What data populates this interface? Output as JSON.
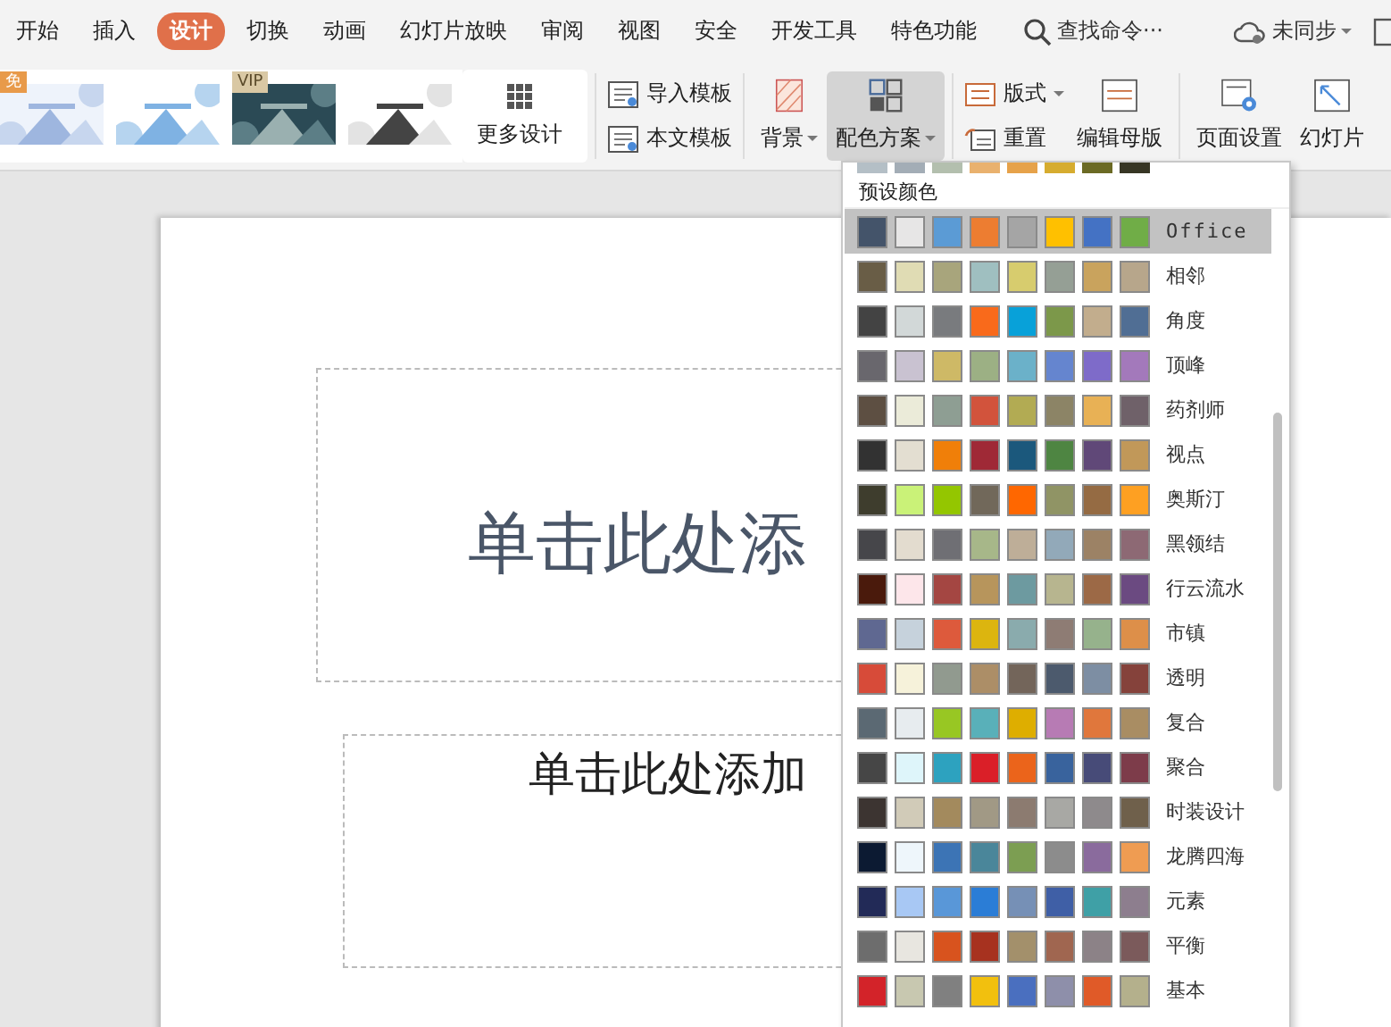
{
  "tabs": [
    {
      "label": "开始",
      "selected": false
    },
    {
      "label": "插入",
      "selected": false
    },
    {
      "label": "设计",
      "selected": true
    },
    {
      "label": "切换",
      "selected": false
    },
    {
      "label": "动画",
      "selected": false
    },
    {
      "label": "幻灯片放映",
      "selected": false
    },
    {
      "label": "审阅",
      "selected": false
    },
    {
      "label": "视图",
      "selected": false
    },
    {
      "label": "安全",
      "selected": false
    },
    {
      "label": "开发工具",
      "selected": false
    },
    {
      "label": "特色功能",
      "selected": false
    }
  ],
  "search": {
    "placeholder": "查找命令···"
  },
  "sync": {
    "label": "未同步"
  },
  "ribbon": {
    "designs": [
      {
        "kind": "picture",
        "badge": "免"
      },
      {
        "kind": "picture"
      },
      {
        "kind": "picture",
        "badge": "VIP"
      },
      {
        "kind": "picture"
      }
    ],
    "more_designs": "更多设计",
    "template_buttons": [
      "导入模板",
      "本文模板"
    ],
    "background": "背景",
    "color_scheme": {
      "label": "配色方案",
      "open": true
    },
    "layout_buttons": [
      "版式",
      "重置"
    ],
    "edit_master": "编辑母版",
    "page_setup": "页面设置",
    "slide_size": "幻灯片"
  },
  "slide": {
    "title_placeholder": "单击此处添",
    "subtitle_placeholder": "单击此处添加"
  },
  "color_menu": {
    "top_row": [
      {
        "color": "#b4bfc6"
      },
      {
        "color": "#a3adb6"
      },
      {
        "color": "#b3bfae"
      },
      {
        "color": "#e9b16e"
      },
      {
        "color": "#e6a24a"
      },
      {
        "color": "#d6ac2f"
      },
      {
        "color": "#6b6a24"
      },
      {
        "color": "#373624"
      }
    ],
    "header": "预设颜色",
    "schemes": [
      {
        "name": "Office",
        "selected": true,
        "swatches": [
          {
            "color": "#44546a"
          },
          {
            "color": "#e7e6e6"
          },
          {
            "color": "#5b9bd5"
          },
          {
            "color": "#ed7d31"
          },
          {
            "color": "#a5a5a5"
          },
          {
            "color": "#ffc000"
          },
          {
            "color": "#4472c4"
          },
          {
            "color": "#70ad47"
          }
        ]
      },
      {
        "name": "相邻",
        "selected": false,
        "swatches": [
          {
            "color": "#695d46"
          },
          {
            "color": "#e0dcb4"
          },
          {
            "color": "#a8a57c"
          },
          {
            "color": "#9fbfc0"
          },
          {
            "color": "#d7cc6e"
          },
          {
            "color": "#959f95"
          },
          {
            "color": "#c9a35d"
          },
          {
            "color": "#b7a68b"
          }
        ]
      },
      {
        "name": "角度",
        "selected": false,
        "swatches": [
          {
            "color": "#434343"
          },
          {
            "color": "#d2d8d8"
          },
          {
            "color": "#797b7e"
          },
          {
            "color": "#f96a1b"
          },
          {
            "color": "#08a1d9"
          },
          {
            "color": "#7c984a"
          },
          {
            "color": "#c2ad8d"
          },
          {
            "color": "#506e94"
          }
        ]
      },
      {
        "name": "顶峰",
        "selected": false,
        "swatches": [
          {
            "color": "#69676d"
          },
          {
            "color": "#c9c2d1"
          },
          {
            "color": "#ceb966"
          },
          {
            "color": "#9cb084"
          },
          {
            "color": "#6bb1c9"
          },
          {
            "color": "#6585cf"
          },
          {
            "color": "#7e6bc9"
          },
          {
            "color": "#a379bb"
          }
        ]
      },
      {
        "name": "药剂师",
        "selected": false,
        "swatches": [
          {
            "color": "#5d4f42"
          },
          {
            "color": "#ebebd9"
          },
          {
            "color": "#8e9e93"
          },
          {
            "color": "#d2533c"
          },
          {
            "color": "#b2ab53"
          },
          {
            "color": "#8c8466"
          },
          {
            "color": "#e8b155"
          },
          {
            "color": "#6f6169"
          }
        ]
      },
      {
        "name": "视点",
        "selected": false,
        "swatches": [
          {
            "color": "#323232"
          },
          {
            "color": "#e3ded1"
          },
          {
            "color": "#f07f09"
          },
          {
            "color": "#9f2936"
          },
          {
            "color": "#1b587c"
          },
          {
            "color": "#4e8542"
          },
          {
            "color": "#604878"
          },
          {
            "color": "#c19859"
          }
        ]
      },
      {
        "name": "奥斯汀",
        "selected": false,
        "swatches": [
          {
            "color": "#3e3d2d"
          },
          {
            "color": "#caf278"
          },
          {
            "color": "#94c600"
          },
          {
            "color": "#71685a"
          },
          {
            "color": "#ff6700"
          },
          {
            "color": "#909465"
          },
          {
            "color": "#956b43"
          },
          {
            "color": "#fea022"
          }
        ]
      },
      {
        "name": "黑领结",
        "selected": false,
        "swatches": [
          {
            "color": "#46464a"
          },
          {
            "color": "#e3dccf"
          },
          {
            "color": "#6f6f74"
          },
          {
            "color": "#a7b789"
          },
          {
            "color": "#beae98"
          },
          {
            "color": "#92a9b9"
          },
          {
            "color": "#9c8265"
          },
          {
            "color": "#8d6974"
          }
        ]
      },
      {
        "name": "行云流水",
        "selected": false,
        "swatches": [
          {
            "color": "#4a1a0c"
          },
          {
            "color": "#fde6ea"
          },
          {
            "color": "#a44642"
          },
          {
            "color": "#b7955c"
          },
          {
            "color": "#6d9aa0"
          },
          {
            "color": "#b7b58f"
          },
          {
            "color": "#9c6946"
          },
          {
            "color": "#6b4a81"
          }
        ]
      },
      {
        "name": "市镇",
        "selected": false,
        "swatches": [
          {
            "color": "#5f6891"
          },
          {
            "color": "#c6d2dc"
          },
          {
            "color": "#dd5a3c"
          },
          {
            "color": "#dcb50f"
          },
          {
            "color": "#8aabad"
          },
          {
            "color": "#8e7c74"
          },
          {
            "color": "#96b28c"
          },
          {
            "color": "#dd8f49"
          }
        ]
      },
      {
        "name": "透明",
        "selected": false,
        "swatches": [
          {
            "color": "#d74b39"
          },
          {
            "color": "#f6f2da"
          },
          {
            "color": "#919a8f"
          },
          {
            "color": "#ac8e67"
          },
          {
            "color": "#73655a"
          },
          {
            "color": "#4c5a6d"
          },
          {
            "color": "#7d8ea3"
          },
          {
            "color": "#85423b"
          }
        ]
      },
      {
        "name": "复合",
        "selected": false,
        "swatches": [
          {
            "color": "#5b6973"
          },
          {
            "color": "#e7ecef"
          },
          {
            "color": "#98c723"
          },
          {
            "color": "#59b0b9"
          },
          {
            "color": "#deae00"
          },
          {
            "color": "#b77bb4"
          },
          {
            "color": "#e0773c"
          },
          {
            "color": "#a98d63"
          }
        ]
      },
      {
        "name": "聚合",
        "selected": false,
        "swatches": [
          {
            "color": "#464646"
          },
          {
            "color": "#def5fa"
          },
          {
            "color": "#2da2bf"
          },
          {
            "color": "#da1f28"
          },
          {
            "color": "#eb641b"
          },
          {
            "color": "#39639d"
          },
          {
            "color": "#474b78"
          },
          {
            "color": "#7d3c4a"
          }
        ]
      },
      {
        "name": "时装设计",
        "selected": false,
        "swatches": [
          {
            "color": "#3c3431"
          },
          {
            "color": "#d1cbb8"
          },
          {
            "color": "#a38a5d"
          },
          {
            "color": "#a19985"
          },
          {
            "color": "#8c7b70"
          },
          {
            "color": "#a8a8a4"
          },
          {
            "color": "#8e8a8c"
          },
          {
            "color": "#6f604b"
          }
        ]
      },
      {
        "name": "龙腾四海",
        "selected": false,
        "swatches": [
          {
            "color": "#0c1a32"
          },
          {
            "color": "#eef6fb"
          },
          {
            "color": "#3c74b5"
          },
          {
            "color": "#4a869a"
          },
          {
            "color": "#7c9e52"
          },
          {
            "color": "#8c8c8c"
          },
          {
            "color": "#8a6b9d"
          },
          {
            "color": "#ef9c52"
          }
        ]
      },
      {
        "name": "元素",
        "selected": false,
        "swatches": [
          {
            "color": "#222a57"
          },
          {
            "color": "#a8c8f4"
          },
          {
            "color": "#5997d8"
          },
          {
            "color": "#2b7dd6"
          },
          {
            "color": "#7690b6"
          },
          {
            "color": "#3f5fa6"
          },
          {
            "color": "#3fa0a6"
          },
          {
            "color": "#8d7e8e"
          }
        ]
      },
      {
        "name": "平衡",
        "selected": false,
        "swatches": [
          {
            "color": "#6d6d6d"
          },
          {
            "color": "#e8e6e0"
          },
          {
            "color": "#d8531e"
          },
          {
            "color": "#a7321f"
          },
          {
            "color": "#a3906b"
          },
          {
            "color": "#a06650"
          },
          {
            "color": "#8c8287"
          },
          {
            "color": "#7b5a5b"
          }
        ]
      },
      {
        "name": "基本",
        "selected": false,
        "swatches": [
          {
            "color": "#d32329"
          },
          {
            "color": "#c8c8b0"
          },
          {
            "color": "#808080"
          },
          {
            "color": "#f2c00e"
          },
          {
            "color": "#4a6fbf"
          },
          {
            "color": "#8e8faa"
          },
          {
            "color": "#e05a28"
          },
          {
            "color": "#b4b08c"
          }
        ]
      }
    ]
  }
}
